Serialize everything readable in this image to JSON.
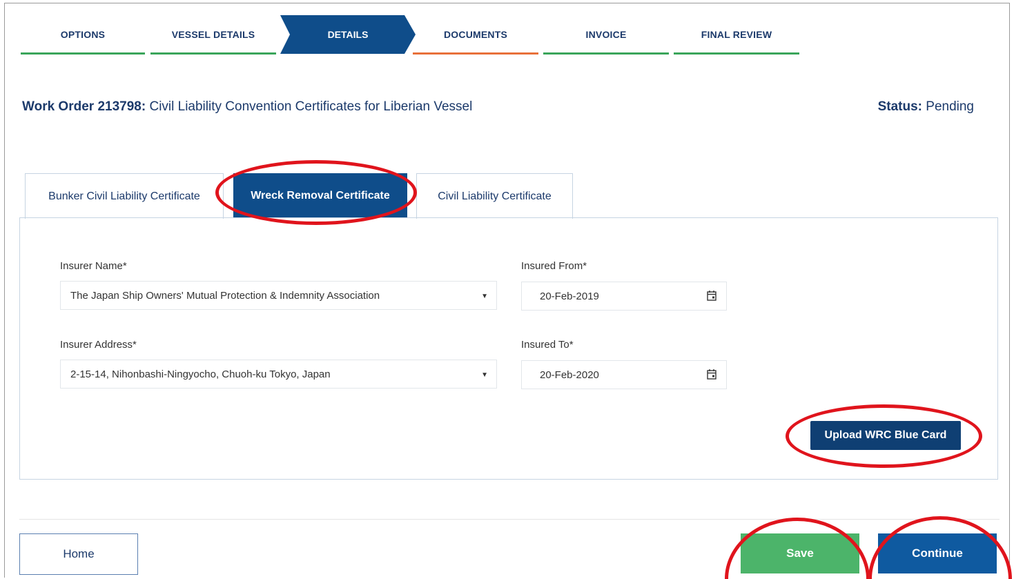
{
  "steps": [
    {
      "label": "OPTIONS",
      "state": "complete"
    },
    {
      "label": "VESSEL DETAILS",
      "state": "complete"
    },
    {
      "label": "DETAILS",
      "state": "active"
    },
    {
      "label": "DOCUMENTS",
      "state": "warning"
    },
    {
      "label": "INVOICE",
      "state": "complete"
    },
    {
      "label": "FINAL REVIEW",
      "state": "complete"
    }
  ],
  "work_order": {
    "prefix": "Work Order 213798:",
    "title": "Civil Liability Convention Certificates for Liberian Vessel"
  },
  "status": {
    "label": "Status:",
    "value": "Pending"
  },
  "tabs": [
    {
      "label": "Bunker Civil Liability Certificate",
      "active": false
    },
    {
      "label": "Wreck Removal Certificate",
      "active": true
    },
    {
      "label": "Civil Liability Certificate",
      "active": false
    }
  ],
  "form": {
    "insurer_name_label": "Insurer Name*",
    "insurer_name_value": "The Japan Ship Owners' Mutual Protection & Indemnity Association",
    "insurer_address_label": "Insurer Address*",
    "insurer_address_value": "2-15-14, Nihonbashi-Ningyocho, Chuoh-ku Tokyo, Japan",
    "insured_from_label": "Insured From*",
    "insured_from_value": "20-Feb-2019",
    "insured_to_label": "Insured To*",
    "insured_to_value": "20-Feb-2020"
  },
  "buttons": {
    "upload": "Upload WRC Blue Card",
    "home": "Home",
    "save": "Save",
    "continue": "Continue"
  },
  "colors": {
    "complete": "#3aa55a",
    "warning": "#e8703a",
    "active": "#0f4d8a",
    "annotation": "#e0141c"
  },
  "icons": {
    "select_caret": "▼",
    "calendar": "calendar-icon"
  }
}
